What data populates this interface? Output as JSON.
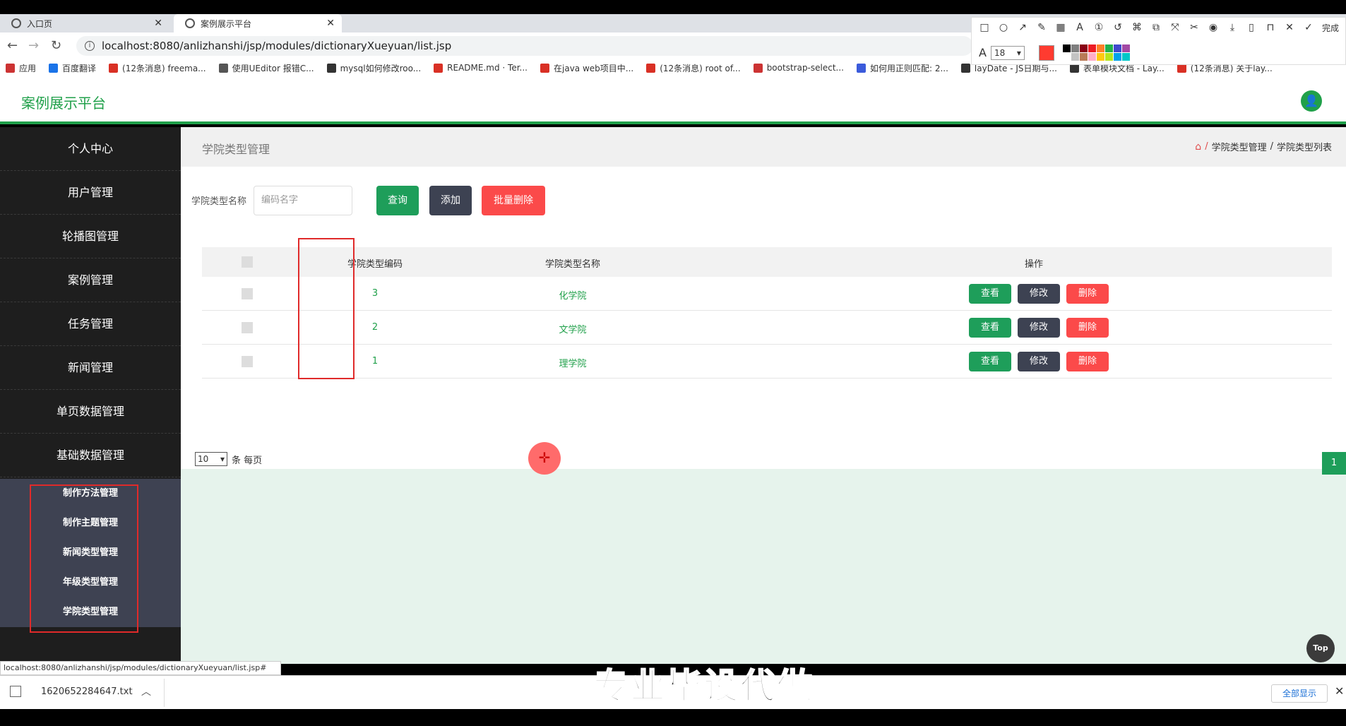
{
  "browser": {
    "tabs": [
      {
        "title": "入口页",
        "active": false
      },
      {
        "title": "案例展示平台",
        "active": true
      }
    ],
    "url": "localhost:8080/anlizhanshi/jsp/modules/dictionaryXueyuan/list.jsp",
    "bookmarks": [
      "应用",
      "百度翻译",
      "(12条消息) freema...",
      "使用UEditor 报错C...",
      "mysql如何修改roo...",
      "README.md · Ter...",
      "在java web项目中...",
      "(12条消息) root of...",
      "bootstrap-select...",
      "如何用正则匹配: 2...",
      "layDate - JS日期与...",
      "表单模块文档 - Lay...",
      "(12条消息) 关于lay..."
    ]
  },
  "annotation_toolbar": {
    "done_label": "完成",
    "font_size": "18",
    "current_color": "#ff3b30",
    "palette": [
      "#000000",
      "#7f7f7f",
      "#880015",
      "#ed1c24",
      "#ff7f27",
      "#22b14c",
      "#3f48cc",
      "#a349a4",
      "#ffffff",
      "#c3c3c3",
      "#b97a57",
      "#ffaec9",
      "#ffc90e",
      "#b5e61d",
      "#00a2e8",
      "#00c8c8"
    ]
  },
  "app": {
    "title": "案例展示平台",
    "brand_color": "#20a04a"
  },
  "sidebar": {
    "items": [
      {
        "label": "个人中心"
      },
      {
        "label": "用户管理"
      },
      {
        "label": "轮播图管理"
      },
      {
        "label": "案例管理"
      },
      {
        "label": "任务管理"
      },
      {
        "label": "新闻管理"
      },
      {
        "label": "单页数据管理"
      },
      {
        "label": "基础数据管理"
      }
    ],
    "submenu": [
      {
        "label": "制作方法管理"
      },
      {
        "label": "制作主题管理"
      },
      {
        "label": "新闻类型管理"
      },
      {
        "label": "年级类型管理"
      },
      {
        "label": "学院类型管理"
      }
    ]
  },
  "main": {
    "page_title": "学院类型管理",
    "breadcrumb": [
      "学院类型管理",
      "/",
      "学院类型列表"
    ],
    "search": {
      "label": "学院类型名称",
      "placeholder": "编码名字"
    },
    "buttons": {
      "query": "查询",
      "add": "添加",
      "batch_delete": "批量删除"
    },
    "table": {
      "columns": [
        "学院类型编码",
        "学院类型名称",
        "操作"
      ],
      "rows": [
        {
          "code": "3",
          "name": "化学院"
        },
        {
          "code": "2",
          "name": "文学院"
        },
        {
          "code": "1",
          "name": "理学院"
        }
      ],
      "actions": {
        "view": "查看",
        "edit": "修改",
        "delete": "删除"
      }
    },
    "pagination": {
      "page_size": "10",
      "page_size_suffix": "条 每页",
      "current_page": "1"
    },
    "top_button": "Top"
  },
  "status_url": "localhost:8080/anlizhanshi/jsp/modules/dictionaryXueyuan/list.jsp#",
  "download_bar": {
    "file": "1620652284647.txt",
    "show_all": "全部显示"
  },
  "watermark": "专业毕设代做"
}
